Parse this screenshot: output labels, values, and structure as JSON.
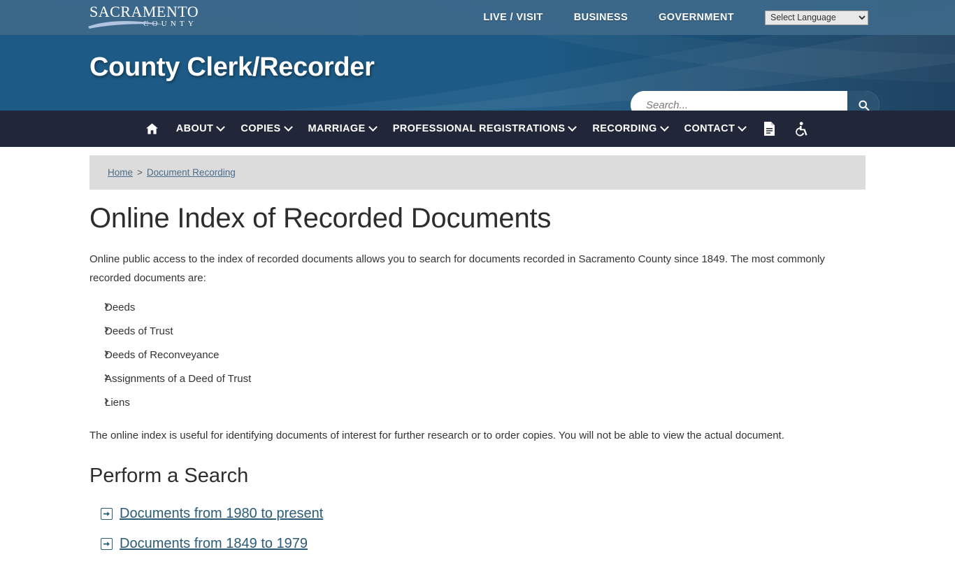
{
  "header": {
    "logo": {
      "main": "Sacramento",
      "sub": "COUNTY"
    },
    "top_links": [
      {
        "label": "LIVE / VISIT"
      },
      {
        "label": "BUSINESS"
      },
      {
        "label": "GOVERNMENT"
      }
    ],
    "language_select": {
      "selected": "Select Language",
      "options": [
        "Select Language"
      ]
    },
    "site_title": "County Clerk/Recorder",
    "search": {
      "placeholder": "Search...",
      "value": "",
      "button_icon": "search-icon"
    }
  },
  "nav": {
    "items": [
      {
        "label": "",
        "icon": "home-icon",
        "caret": false
      },
      {
        "label": "ABOUT",
        "caret": true
      },
      {
        "label": "COPIES",
        "caret": true
      },
      {
        "label": "MARRIAGE",
        "caret": true
      },
      {
        "label": "PROFESSIONAL REGISTRATIONS",
        "caret": true
      },
      {
        "label": "RECORDING",
        "caret": true
      },
      {
        "label": "CONTACT",
        "caret": true
      },
      {
        "label": "",
        "icon": "document-icon",
        "caret": false
      },
      {
        "label": "",
        "icon": "accessibility-icon",
        "caret": false
      }
    ]
  },
  "breadcrumb": {
    "items": [
      {
        "label": "Home"
      },
      {
        "label": "Document Recording"
      }
    ],
    "separator": ">"
  },
  "main": {
    "page_title": "Online Index of Recorded Documents",
    "intro_paragraph": "Online public access to the index of recorded documents allows you to search for documents recorded in Sacramento County since 1849. The most commonly recorded documents are:",
    "document_types": [
      "Deeds",
      "Deeds of Trust",
      "Deeds of Reconveyance",
      "Assignments of a Deed of Trust",
      "Liens"
    ],
    "note_paragraph": "The online index is useful for identifying documents of interest for further research or to order copies. You will not be able to view the actual document.",
    "search_section_heading": "Perform a Search",
    "search_links": [
      {
        "label": "Documents from 1980 to present"
      },
      {
        "label": "Documents from 1849 to 1979"
      }
    ]
  },
  "colors": {
    "header_top": "#3e698a",
    "header_main": "#1d5b86",
    "nav_bar": "#212639",
    "breadcrumb_bg": "#dcdcdc",
    "link_blue": "#2c5c78",
    "crumb_blue": "#4a6d8c",
    "search_btn": "#2b5472"
  }
}
